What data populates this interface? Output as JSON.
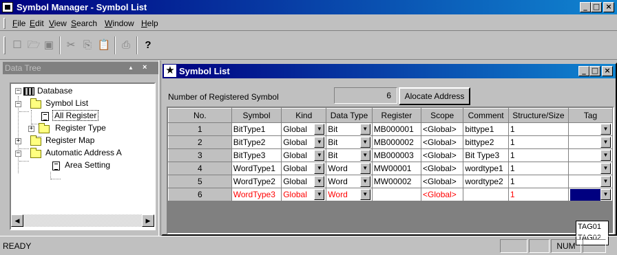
{
  "app": {
    "title": "Symbol Manager - Symbol List",
    "caption_buttons": {
      "minimize": "_",
      "maximize": "□",
      "close": "×"
    }
  },
  "menu": {
    "items": [
      {
        "label": "File",
        "key": "F",
        "rest": "ile"
      },
      {
        "label": "Edit",
        "key": "E",
        "rest": "dit"
      },
      {
        "label": "View",
        "key": "V",
        "rest": "iew"
      },
      {
        "label": "Search",
        "key": "S",
        "rest": "earch"
      },
      {
        "label": "Window",
        "key": "W",
        "rest": "indow"
      },
      {
        "label": "Help",
        "key": "H",
        "rest": "elp"
      }
    ]
  },
  "toolbar": {
    "icons": [
      "new-icon",
      "open-icon",
      "save-icon",
      "cut-icon",
      "copy-icon",
      "paste-icon",
      "print-icon",
      "help-icon"
    ],
    "glyphs": {
      "new": "☐",
      "open": "🗁",
      "save": "▣",
      "cut": "✂",
      "copy": "⎘",
      "paste": "📋",
      "print": "⎙",
      "help": "?"
    }
  },
  "data_tree": {
    "title": "Data Tree",
    "pin": "▲",
    "close": "×",
    "nodes": {
      "database": "Database",
      "symbol_list": "Symbol List",
      "all_register": "All Register",
      "register_type": "Register Type",
      "register_map": "Register Map",
      "automatic_address": "Automatic Address A",
      "area_setting": "Area Setting"
    },
    "expander_minus": "−",
    "expander_plus": "+"
  },
  "symbol_list": {
    "title": "Symbol List",
    "count_label": "Number of  Registered Symbol",
    "count_value": "6",
    "allocate_button": "Alocate Address",
    "columns": [
      "No.",
      "Symbol",
      "Kind",
      "Data Type",
      "Register",
      "Scope",
      "Comment",
      "Structure/Size",
      "Tag"
    ],
    "rows": [
      {
        "no": "1",
        "symbol": "BitType1",
        "kind": "Global",
        "data_type": "Bit",
        "register": "MB000001",
        "scope": "<Global>",
        "comment": "bittype1",
        "size": "1",
        "tag": ""
      },
      {
        "no": "2",
        "symbol": "BitType2",
        "kind": "Global",
        "data_type": "Bit",
        "register": "MB000002",
        "scope": "<Global>",
        "comment": "bittype2",
        "size": "1",
        "tag": ""
      },
      {
        "no": "3",
        "symbol": "BitType3",
        "kind": "Global",
        "data_type": "Bit",
        "register": "MB000003",
        "scope": "<Global>",
        "comment": "Bit Type3",
        "size": "1",
        "tag": ""
      },
      {
        "no": "4",
        "symbol": "WordType1",
        "kind": "Global",
        "data_type": "Word",
        "register": "MW00001",
        "scope": "<Global>",
        "comment": "wordtype1",
        "size": "1",
        "tag": ""
      },
      {
        "no": "5",
        "symbol": "WordType2",
        "kind": "Global",
        "data_type": "Word",
        "register": "MW00002",
        "scope": "<Global>",
        "comment": "wordtype2",
        "size": "1",
        "tag": ""
      },
      {
        "no": "6",
        "symbol": "WordType3",
        "kind": "Global",
        "data_type": "Word",
        "register": "",
        "scope": "<Global>",
        "comment": "",
        "size": "1",
        "tag": ""
      }
    ],
    "tag_options": [
      "TAG01",
      "TAG02"
    ],
    "dropdown_arrow": "▼",
    "colors": {
      "new_row_text": "#ff0000",
      "selected": "#000080"
    }
  },
  "status": {
    "text": "READY",
    "num": "NUM"
  }
}
